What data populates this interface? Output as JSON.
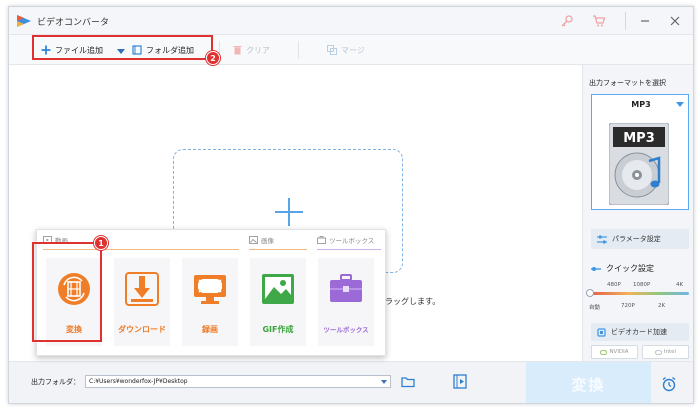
{
  "window": {
    "title": "ビデオコンバータ"
  },
  "toolbar": {
    "add_file": "ファイル追加",
    "add_folder": "フォルダ追加",
    "clear": "クリア",
    "merge": "マージ"
  },
  "main": {
    "drop_hint": "でドラッグします。"
  },
  "menu": {
    "sections": {
      "video": "動画",
      "image": "画像",
      "toolbox": "ツールボックス"
    },
    "tiles": [
      {
        "label": "変換",
        "icon": "film-convert-icon"
      },
      {
        "label": "ダウンロード",
        "icon": "download-icon"
      },
      {
        "label": "録画",
        "icon": "screen-record-icon"
      },
      {
        "label": "GIF作成",
        "icon": "image-gif-icon"
      },
      {
        "label": "ツールボックス",
        "icon": "toolbox-icon"
      }
    ]
  },
  "right_panel": {
    "output_format_label": "出力フォーマットを選択",
    "format": "MP3",
    "format_icon_text": "MP3",
    "param_settings": "パラメータ設定",
    "quick_settings": "クイック設定",
    "quality_top": [
      "480P",
      "1080P",
      "4K"
    ],
    "quality_bottom": [
      "自動",
      "720P",
      "2K"
    ],
    "gpu_accel": "ビデオカード加速",
    "gpu_vendors": [
      "NVIDIA",
      "Intel"
    ]
  },
  "bottom": {
    "output_folder_label": "出力フォルダ：",
    "output_path": "C:¥Users¥wonderfox-JP¥Desktop",
    "convert_button": "変換"
  },
  "annotations": {
    "badge1": "1",
    "badge2": "2"
  },
  "colors": {
    "accent_blue": "#3e97e6",
    "orange": "#ef7a25",
    "annotation_red": "#e03131",
    "green": "#39a33b",
    "purple": "#9b6ad6"
  }
}
